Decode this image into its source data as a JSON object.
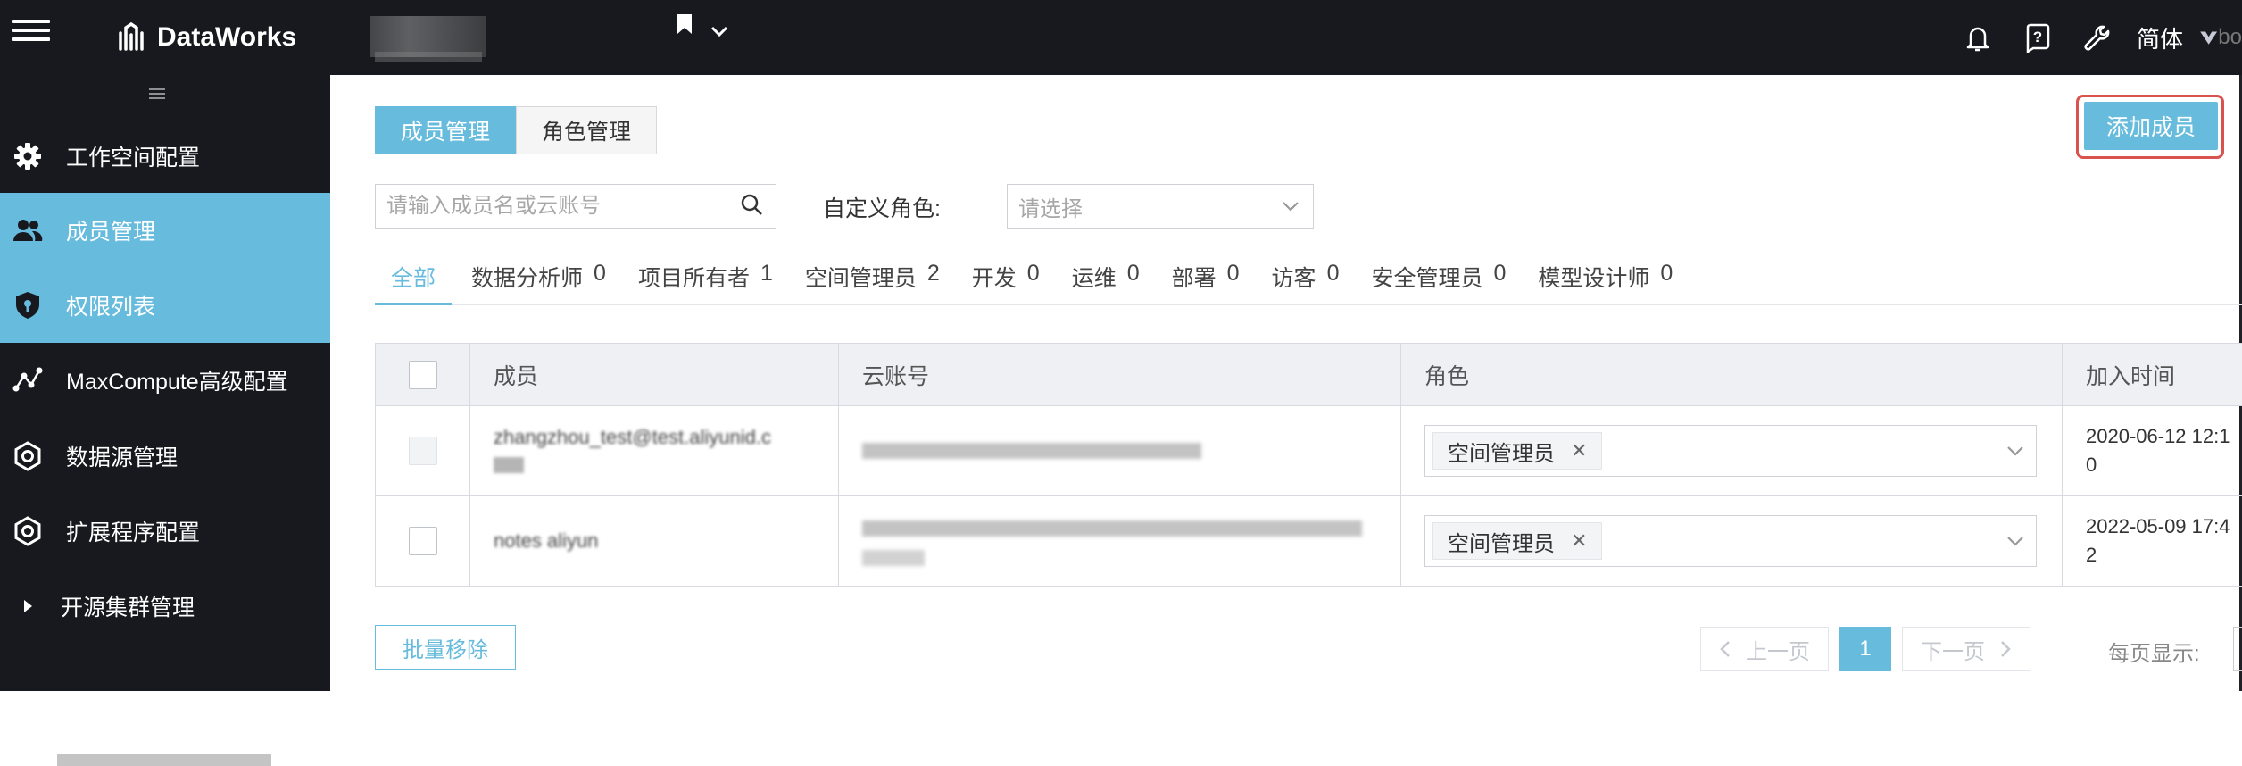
{
  "topbar": {
    "product_name": "DataWorks",
    "language": "简体"
  },
  "sidebar": {
    "items": [
      {
        "label": "工作空间配置",
        "icon": "gear-icon"
      },
      {
        "label": "成员管理",
        "icon": "users-icon"
      },
      {
        "label": "权限列表",
        "icon": "shield-icon"
      },
      {
        "label": "MaxCompute高级配置",
        "icon": "graph-icon"
      },
      {
        "label": "数据源管理",
        "icon": "datasource-icon"
      },
      {
        "label": "扩展程序配置",
        "icon": "extension-icon"
      },
      {
        "label": "开源集群管理",
        "icon": "caret-right-icon"
      }
    ]
  },
  "main": {
    "tabs": [
      {
        "label": "成员管理"
      },
      {
        "label": "角色管理"
      }
    ],
    "add_member_label": "添加成员",
    "search": {
      "placeholder": "请输入成员名或云账号"
    },
    "custom_role_label": "自定义角色:",
    "role_select_placeholder": "请选择",
    "role_filters": [
      {
        "label": "全部",
        "count": ""
      },
      {
        "label": "数据分析师",
        "count": "0"
      },
      {
        "label": "项目所有者",
        "count": "1"
      },
      {
        "label": "空间管理员",
        "count": "2"
      },
      {
        "label": "开发",
        "count": "0"
      },
      {
        "label": "运维",
        "count": "0"
      },
      {
        "label": "部署",
        "count": "0"
      },
      {
        "label": "访客",
        "count": "0"
      },
      {
        "label": "安全管理员",
        "count": "0"
      },
      {
        "label": "模型设计师",
        "count": "0"
      }
    ],
    "table": {
      "columns": [
        "成员",
        "云账号",
        "角色",
        "加入时间"
      ],
      "rows": [
        {
          "member": "zhangzhou_test@test.aliyunid.c",
          "role": "空间管理员",
          "time_line1": "2020-06-12 12:1",
          "time_line2": "0"
        },
        {
          "member": "notes aliyun",
          "role": "空间管理员",
          "time_line1": "2022-05-09 17:4",
          "time_line2": "2"
        }
      ]
    },
    "bulk_remove_label": "批量移除",
    "pagination": {
      "prev_label": "上一页",
      "current_page": "1",
      "next_label": "下一页",
      "per_page_label": "每页显示:"
    }
  }
}
